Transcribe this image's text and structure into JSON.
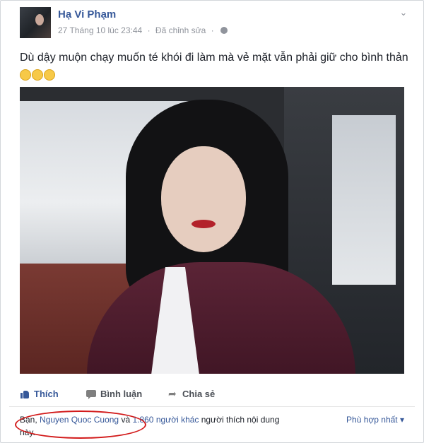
{
  "post": {
    "author": "Hạ Vi Phạm",
    "timestamp": "27 Tháng 10 lúc 23:44",
    "edited": "Đã chỉnh sửa",
    "separator": "·",
    "text": "Dù dậy muộn chạy muốn té khói đi làm mà vẻ mặt vẫn phải giữ cho bình thản",
    "emoji_count": 3,
    "privacy_icon": "globe-icon",
    "menu_icon": "chevron-down-icon"
  },
  "actions": {
    "like": "Thích",
    "comment": "Bình luận",
    "share": "Chia sẻ"
  },
  "likes": {
    "prefix": "Bạn, ",
    "friend": "Nguyen Quoc Cuong",
    "joiner": " và ",
    "others": "1.860 người khác",
    "suffix": " người thích nội dung",
    "line2": "này.",
    "sort": "Phù hợp nhất ▾"
  },
  "colors": {
    "link": "#365899",
    "highlight_circle": "#d21a1a"
  }
}
